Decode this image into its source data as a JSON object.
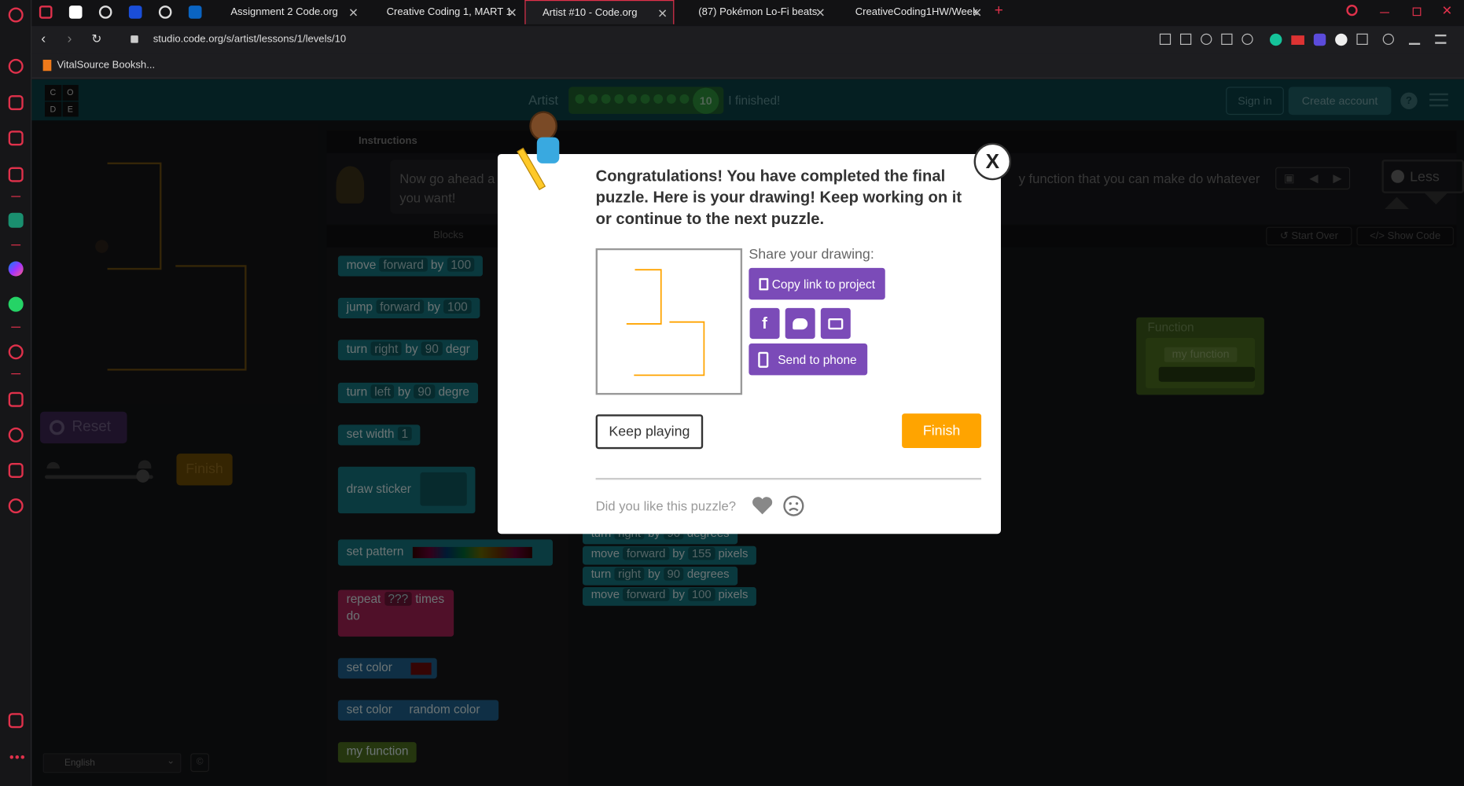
{
  "browser": {
    "tabs": [
      {
        "title": "Assignment 2 Code.org"
      },
      {
        "title": "Creative Coding 1, MART 1"
      },
      {
        "title": "Artist #10 - Code.org"
      },
      {
        "title": "(87) Pokémon Lo-Fi beats"
      },
      {
        "title": "CreativeCoding1HW/Week"
      }
    ],
    "url": "studio.code.org/s/artist/lessons/1/levels/10",
    "bookmark": "VitalSource Booksh...",
    "new_tab": "+"
  },
  "header": {
    "logo_letters": [
      "C",
      "O",
      "D",
      "E"
    ],
    "title": "Artist",
    "level_number": "10",
    "finished_label": "I finished!",
    "sign_in": "Sign in",
    "create_account": "Create account",
    "help": "?"
  },
  "instructions": {
    "tab": "Instructions",
    "text_line1": "Now go ahead a",
    "text_line2": "you want!",
    "text_right": "y function that you can make do whatever",
    "less": "Less"
  },
  "workspace": {
    "blocks_header": "Blocks",
    "start_over": "Start Over",
    "show_code": "Show Code",
    "function_block": "Function",
    "function_name": "my function"
  },
  "toolbox": [
    {
      "text": "move",
      "f1": "forward",
      "mid": "by",
      "f2": "100"
    },
    {
      "text": "jump",
      "f1": "forward",
      "mid": "by",
      "f2": "100"
    },
    {
      "text": "turn",
      "f1": "right",
      "mid": "by",
      "f2": "90",
      "tail": "degr"
    },
    {
      "text": "turn",
      "f1": "left",
      "mid": "by",
      "f2": "90",
      "tail": "degre"
    },
    {
      "text": "set width",
      "f1": "1"
    },
    {
      "text": "draw sticker"
    },
    {
      "text": "set pattern"
    },
    {
      "text": "repeat",
      "f1": "???",
      "mid": "times",
      "line2": "do"
    },
    {
      "text": "set color"
    },
    {
      "text": "set color",
      "tail": "random color"
    },
    {
      "text": "my function"
    }
  ],
  "script_blocks": [
    {
      "a": "turn",
      "f1": "right",
      "b": "by",
      "f2": "90",
      "c": "degrees"
    },
    {
      "a": "move",
      "f1": "forward",
      "b": "by",
      "f2": "155",
      "c": "pixels"
    },
    {
      "a": "turn",
      "f1": "right",
      "b": "by",
      "f2": "90",
      "c": "degrees"
    },
    {
      "a": "move",
      "f1": "forward",
      "b": "by",
      "f2": "100",
      "c": "pixels"
    }
  ],
  "controls": {
    "reset": "Reset",
    "finish": "Finish",
    "language": "English"
  },
  "modal": {
    "message": "Congratulations! You have completed the final puzzle. Here is your drawing! Keep working on it or continue to the next puzzle.",
    "share_label": "Share your drawing:",
    "copy_link": "Copy link to project",
    "send_to_phone": "Send to phone",
    "keep_playing": "Keep playing",
    "finish": "Finish",
    "feedback_question": "Did you like this puzzle?",
    "close": "X"
  },
  "colors": {
    "accent_opera": "#e0314b",
    "finish_orange": "#ffa400",
    "share_purple": "#7b4bb8",
    "header_teal": "#0b3e44"
  }
}
